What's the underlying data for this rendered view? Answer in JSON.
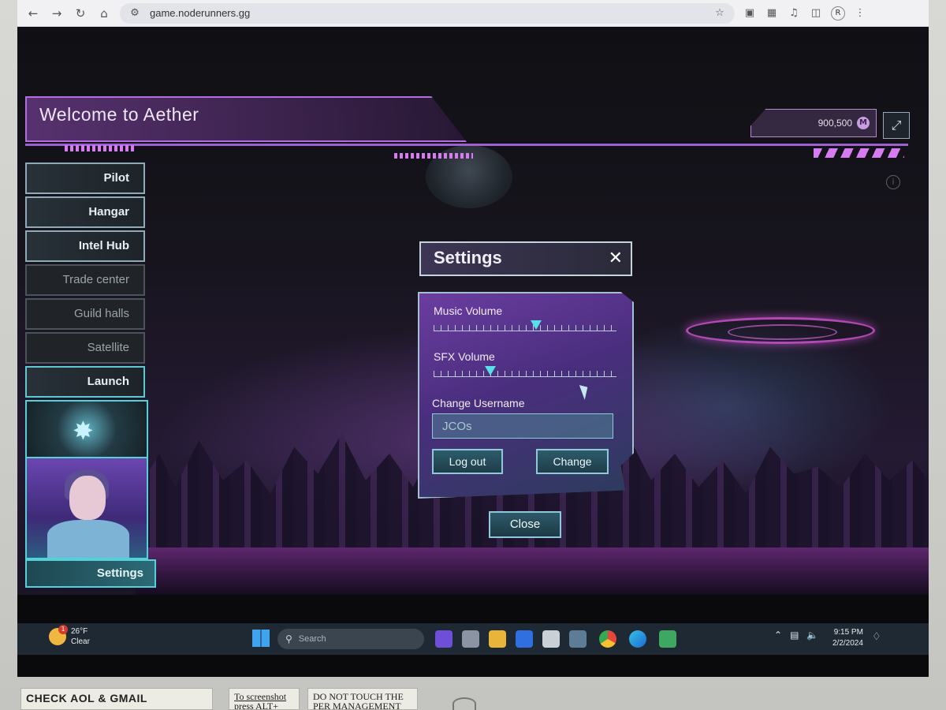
{
  "browser": {
    "url": "game.noderunners.gg",
    "profile_initial": "R"
  },
  "header": {
    "title": "Welcome to Aether",
    "currency_value": "900,500",
    "currency_symbol": "M"
  },
  "sidebar": {
    "items": [
      {
        "label": "Pilot",
        "state": "active"
      },
      {
        "label": "Hangar",
        "state": "active"
      },
      {
        "label": "Intel Hub",
        "state": "active"
      },
      {
        "label": "Trade center",
        "state": "dim"
      },
      {
        "label": "Guild halls",
        "state": "dim"
      },
      {
        "label": "Satellite",
        "state": "dim"
      },
      {
        "label": "Launch",
        "state": "launch"
      }
    ],
    "settings_label": "Settings"
  },
  "settings_modal": {
    "title": "Settings",
    "music_label": "Music Volume",
    "music_level": 0.56,
    "sfx_label": "SFX Volume",
    "sfx_level": 0.31,
    "username_label": "Change Username",
    "username_value": "JCOs",
    "logout_label": "Log out",
    "change_label": "Change",
    "close_label": "Close"
  },
  "taskbar": {
    "weather_temp": "26°F",
    "weather_desc": "Clear",
    "weather_badge": "1",
    "search_placeholder": "Search",
    "time": "9:15 PM",
    "date": "2/2/2024"
  },
  "stickers": {
    "left": "CHECK AOL & GMAIL",
    "middle_line1": "To screenshot",
    "middle_line2": "press ALT+",
    "right_line1": "DO NOT TOUCH THE",
    "right_line2": "PER MANAGEMENT"
  },
  "colors": {
    "accent_purple": "#b26de0",
    "accent_cyan": "#53d0d8"
  }
}
